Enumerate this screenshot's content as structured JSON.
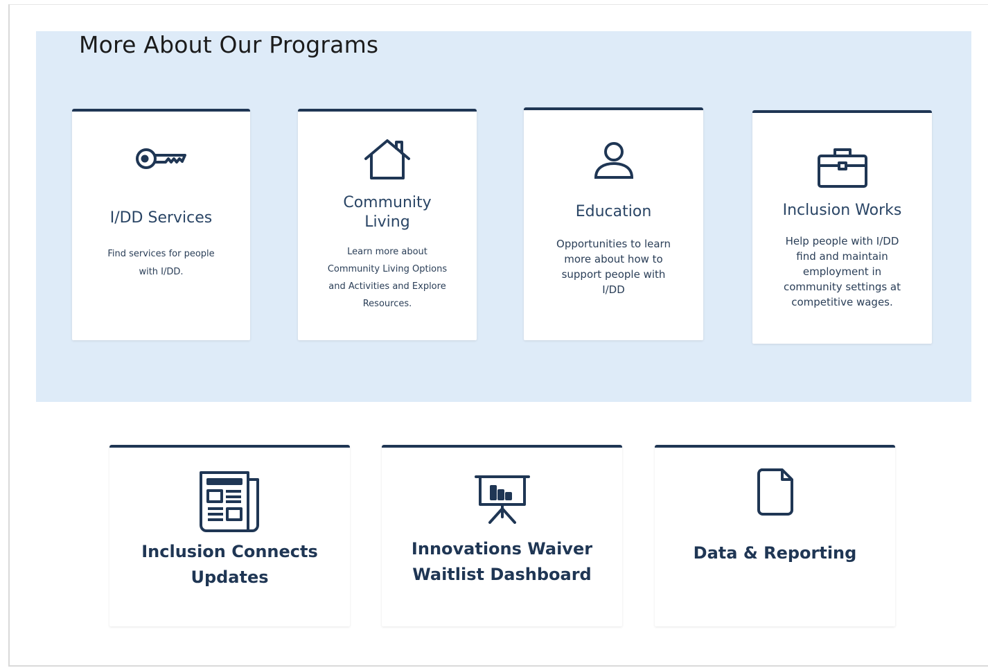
{
  "section": {
    "title": "More About Our Programs"
  },
  "program_cards": [
    {
      "icon": "key-icon",
      "title": "I/DD Services",
      "description": "Find services for people with I/DD."
    },
    {
      "icon": "house-icon",
      "title": "Community Living",
      "description": "Learn more about Community Living Options and Activities and Explore Resources."
    },
    {
      "icon": "person-icon",
      "title": "Education",
      "description": "Opportunities to learn more about how to support people with I/DD"
    },
    {
      "icon": "briefcase-icon",
      "title": "Inclusion Works",
      "description": "Help people with I/DD find and maintain employment in community settings at competitive wages."
    }
  ],
  "link_cards": [
    {
      "icon": "newspaper-icon",
      "title": "Inclusion Connects Updates"
    },
    {
      "icon": "presentation-chart-icon",
      "title": "Innovations Waiver Waitlist Dashboard"
    },
    {
      "icon": "document-icon",
      "title": "Data & Reporting"
    }
  ],
  "colors": {
    "section_background": "#deebf8",
    "card_accent": "#1f3654",
    "text_dark": "#1b1b1b"
  }
}
